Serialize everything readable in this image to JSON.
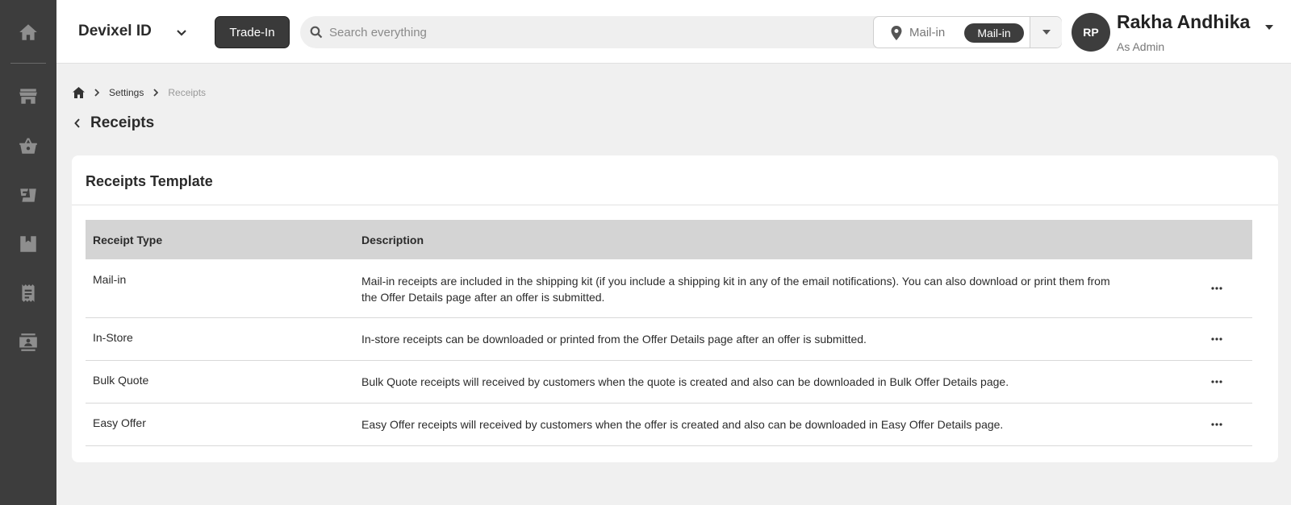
{
  "header": {
    "brand": "Devixel ID",
    "tradein_label": "Trade-In",
    "search_placeholder": "Search everything",
    "location_label": "Mail-in",
    "location_value": "Mail-in",
    "user_initials": "RP",
    "user_name": "Rakha Andhika",
    "user_role": "As Admin"
  },
  "breadcrumb": {
    "items": [
      "Settings",
      "Receipts"
    ]
  },
  "page": {
    "title": "Receipts"
  },
  "card": {
    "title": "Receipts Template",
    "columns": [
      "Receipt Type",
      "Description"
    ],
    "rows": [
      {
        "type": "Mail-in",
        "description": "Mail-in receipts are included in the shipping kit (if you include a shipping kit in any of the email notifications). You can also download or print them from the Offer Details page after an offer is submitted."
      },
      {
        "type": "In-Store",
        "description": "In-store receipts can be downloaded or printed from the Offer Details page after an offer is submitted."
      },
      {
        "type": "Bulk Quote",
        "description": "Bulk Quote receipts will received by customers when the quote is created and also can be downloaded in Bulk Offer Details page."
      },
      {
        "type": "Easy Offer",
        "description": "Easy Offer receipts will received by customers when the offer is created and also can be downloaded in Easy Offer Details page."
      }
    ]
  },
  "icons": {
    "sidebar": [
      "home-icon",
      "store-icon",
      "basket-icon",
      "delivery-icon",
      "inventory-icon",
      "receipt-icon",
      "contact-card-icon"
    ]
  },
  "colors": {
    "sidebar_bg": "#3d3d3d",
    "accent_dark": "#3a3a3a",
    "table_header_bg": "#d4d4d4",
    "page_bg": "#f0f0f0"
  }
}
